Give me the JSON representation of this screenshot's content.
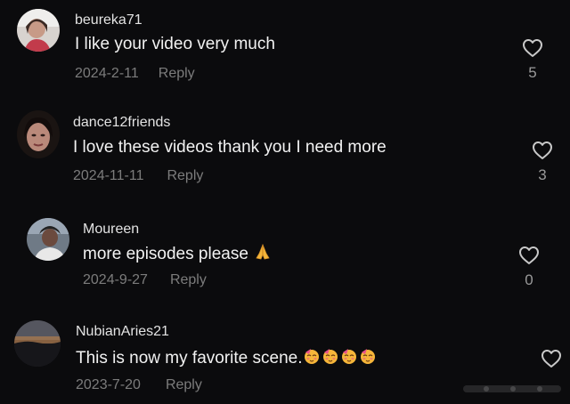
{
  "comments": [
    {
      "username": "beureka71",
      "text": "I like your video very much",
      "date": "2024-2-11",
      "reply_label": "Reply",
      "likes": "5"
    },
    {
      "username": "dance12friends",
      "text": "I love these videos thank you I need more",
      "date": "2024-11-11",
      "reply_label": "Reply",
      "likes": "3"
    },
    {
      "username": "Moureen",
      "text": "more episodes please",
      "date": "2024-9-27",
      "reply_label": "Reply",
      "likes": "0"
    },
    {
      "username": "NubianAries21",
      "text": "This is now my favorite scene.",
      "date": "2023-7-20",
      "reply_label": "Reply",
      "likes": ""
    }
  ],
  "icons": {
    "like": "heart-outline-icon",
    "praying_hands": "folded-hands-emoji",
    "party_face": "partying-face-emoji"
  },
  "colors": {
    "background": "#0b0b0d",
    "username": "#e3e3e3",
    "text": "#f2f2f2",
    "meta": "#7c7c7c"
  }
}
